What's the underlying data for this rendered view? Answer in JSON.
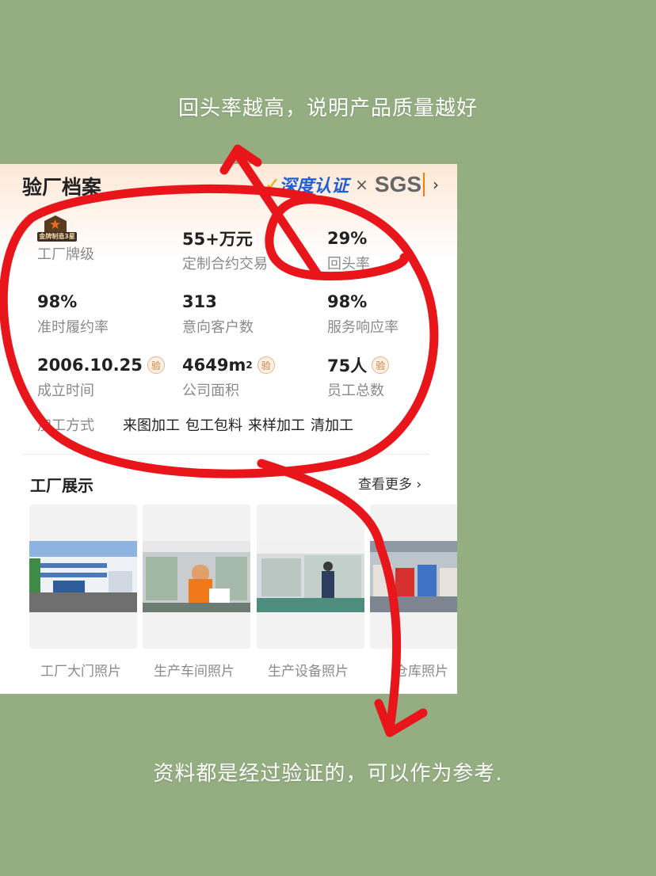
{
  "captions": {
    "top": "回头率越高，说明产品质量越好",
    "bottom": "资料都是经过验证的，可以作为参考."
  },
  "card": {
    "title": "验厂档案",
    "cert": {
      "brand": "深度认证",
      "separator": "×",
      "sgs": "SGS",
      "arrow_icon": "chevron-right-icon"
    },
    "stats": [
      {
        "value": "",
        "label": "工厂牌级",
        "badge": "金牌制造3星"
      },
      {
        "value": "55+万元",
        "label": "定制合约交易"
      },
      {
        "value": "29%",
        "label": "回头率"
      },
      {
        "value": "98%",
        "label": "准时履约率"
      },
      {
        "value": "313",
        "label": "意向客户数"
      },
      {
        "value": "98%",
        "label": "服务响应率"
      },
      {
        "value": "2006.10.25",
        "label": "成立时间",
        "verified": "验"
      },
      {
        "value": "4649m",
        "value_sup": "2",
        "label": "公司面积",
        "verified": "验"
      },
      {
        "value": "75人",
        "label": "员工总数",
        "verified": "验"
      }
    ],
    "process": {
      "label": "加工方式",
      "options": [
        "来图加工",
        "包工包料",
        "来样加工",
        "清加工"
      ]
    },
    "showcase": {
      "title": "工厂展示",
      "more": "查看更多",
      "photos": [
        {
          "label": "工厂大门照片"
        },
        {
          "label": "生产车间照片"
        },
        {
          "label": "生产设备照片"
        },
        {
          "label": "仓库照片"
        }
      ]
    }
  },
  "annotation": {
    "color": "#e8151b"
  }
}
